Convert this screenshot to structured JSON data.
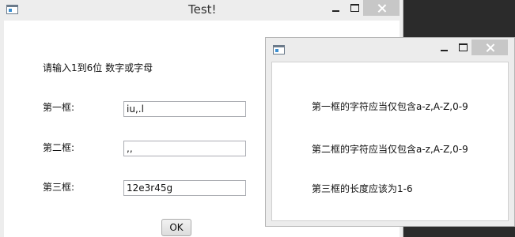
{
  "main_window": {
    "title": "Test!",
    "prompt": "请输入1到6位 数字或字母",
    "fields": [
      {
        "label": "第一框:",
        "value": "iu,.l"
      },
      {
        "label": "第二框:",
        "value": ",,"
      },
      {
        "label": "第三框:",
        "value": "12e3r45g"
      }
    ],
    "ok_label": "OK"
  },
  "dialog": {
    "title": "",
    "messages": [
      "第一框的字符应当仅包含a-z,A-Z,0-9",
      "第二框的字符应当仅包含a-z,A-Z,0-9",
      "第三框的长度应该为1-6"
    ]
  },
  "colors": {
    "desktop": "#2b2b2b",
    "chrome": "#ededed",
    "close_button": "#c7c7c7"
  }
}
